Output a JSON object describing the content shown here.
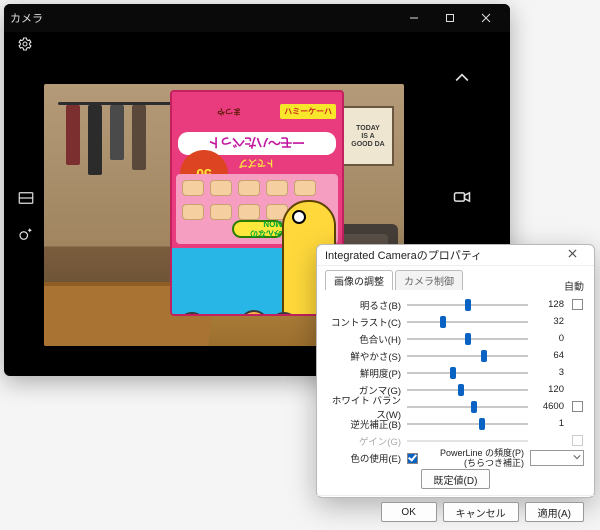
{
  "camera": {
    "title": "カメラ",
    "sign": {
      "l1": "TODAY",
      "l2": "IS A",
      "l3": "GOOD DA"
    },
    "box": {
      "logo_text": "まつや",
      "badge_text": "ハミーケーハ",
      "katakana": "ーモ〜ハたべっト",
      "sub": "トでズブ",
      "burst": "50",
      "ribbon": "みんなのMON"
    }
  },
  "dialog": {
    "title": "Integrated Cameraのプロパティ",
    "tabs": {
      "adjust": "画像の調整",
      "control": "カメラ制御"
    },
    "auto_header": "自動",
    "sliders": {
      "brightness": {
        "label": "明るさ(B)",
        "value": "128",
        "pct": 50
      },
      "contrast": {
        "label": "コントラスト(C)",
        "value": "32",
        "pct": 30
      },
      "hue": {
        "label": "色合い(H)",
        "value": "0",
        "pct": 50
      },
      "saturation": {
        "label": "鮮やかさ(S)",
        "value": "64",
        "pct": 64
      },
      "sharpness": {
        "label": "鮮明度(P)",
        "value": "3",
        "pct": 38
      },
      "gamma": {
        "label": "ガンマ(G)",
        "value": "120",
        "pct": 45
      },
      "whitebalance": {
        "label": "ホワイト バランス(W)",
        "value": "4600",
        "pct": 55
      },
      "backlight": {
        "label": "逆光補正(B)",
        "value": "1",
        "pct": 62
      },
      "gain": {
        "label": "ゲイン(G)",
        "value": "",
        "pct": 0
      }
    },
    "color_enable_label": "色の使用(E)",
    "powerline": {
      "label_a": "PowerLine の頻度(P)",
      "label_b": "(ちらつき補正)"
    },
    "defaults_label": "既定値(D)",
    "buttons": {
      "ok": "OK",
      "cancel": "キャンセル",
      "apply": "適用(A)"
    }
  }
}
